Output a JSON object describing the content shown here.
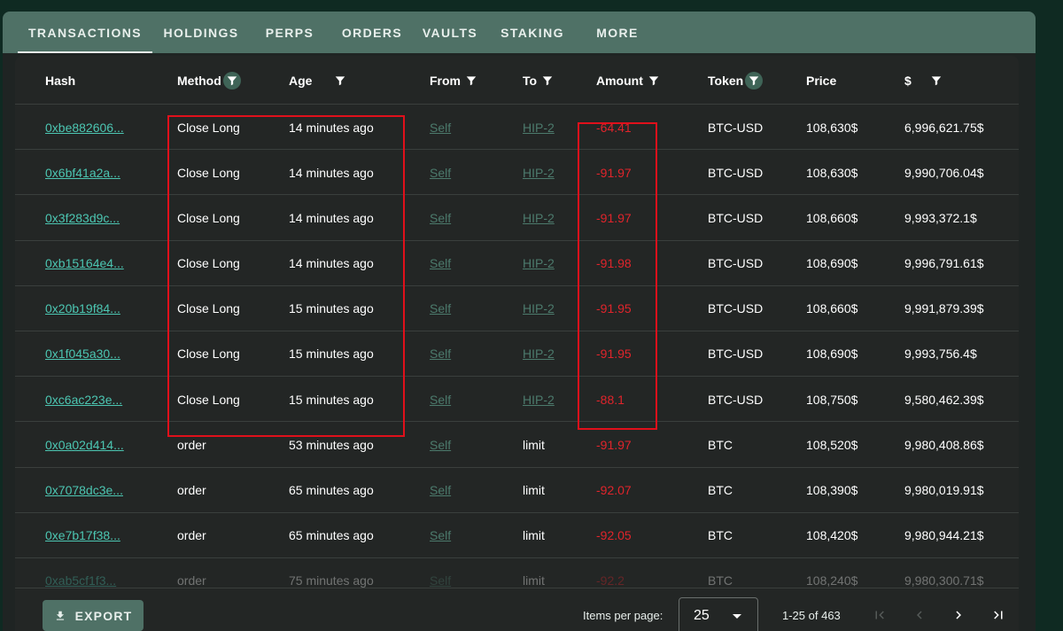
{
  "tabs": [
    {
      "label": "TRANSACTIONS",
      "active": true
    },
    {
      "label": "HOLDINGS"
    },
    {
      "label": "PERPS"
    },
    {
      "label": "ORDERS"
    },
    {
      "label": "VAULTS"
    },
    {
      "label": "STAKING"
    },
    {
      "label": "MORE"
    }
  ],
  "table": {
    "columns": [
      "Hash",
      "Method",
      "Age",
      "From",
      "To",
      "Amount",
      "Token",
      "Price",
      "$"
    ],
    "rows": [
      {
        "hash": "0xbe882606...",
        "method": "Close Long",
        "age": "14 minutes ago",
        "from": "Self",
        "to": "HIP-2",
        "amount": "-64.41",
        "token": "BTC-USD",
        "price": "108,630$",
        "usd": "6,996,621.75$"
      },
      {
        "hash": "0x6bf41a2a...",
        "method": "Close Long",
        "age": "14 minutes ago",
        "from": "Self",
        "to": "HIP-2",
        "amount": "-91.97",
        "token": "BTC-USD",
        "price": "108,630$",
        "usd": "9,990,706.04$"
      },
      {
        "hash": "0x3f283d9c...",
        "method": "Close Long",
        "age": "14 minutes ago",
        "from": "Self",
        "to": "HIP-2",
        "amount": "-91.97",
        "token": "BTC-USD",
        "price": "108,660$",
        "usd": "9,993,372.1$"
      },
      {
        "hash": "0xb15164e4...",
        "method": "Close Long",
        "age": "14 minutes ago",
        "from": "Self",
        "to": "HIP-2",
        "amount": "-91.98",
        "token": "BTC-USD",
        "price": "108,690$",
        "usd": "9,996,791.61$"
      },
      {
        "hash": "0x20b19f84...",
        "method": "Close Long",
        "age": "15 minutes ago",
        "from": "Self",
        "to": "HIP-2",
        "amount": "-91.95",
        "token": "BTC-USD",
        "price": "108,660$",
        "usd": "9,991,879.39$"
      },
      {
        "hash": "0x1f045a30...",
        "method": "Close Long",
        "age": "15 minutes ago",
        "from": "Self",
        "to": "HIP-2",
        "amount": "-91.95",
        "token": "BTC-USD",
        "price": "108,690$",
        "usd": "9,993,756.4$"
      },
      {
        "hash": "0xc6ac223e...",
        "method": "Close Long",
        "age": "15 minutes ago",
        "from": "Self",
        "to": "HIP-2",
        "amount": "-88.1",
        "token": "BTC-USD",
        "price": "108,750$",
        "usd": "9,580,462.39$"
      },
      {
        "hash": "0x0a02d414...",
        "method": "order",
        "age": "53 minutes ago",
        "from": "Self",
        "to": "limit",
        "amount": "-91.97",
        "token": "BTC",
        "price": "108,520$",
        "usd": "9,980,408.86$"
      },
      {
        "hash": "0x7078dc3e...",
        "method": "order",
        "age": "65 minutes ago",
        "from": "Self",
        "to": "limit",
        "amount": "-92.07",
        "token": "BTC",
        "price": "108,390$",
        "usd": "9,980,019.91$"
      },
      {
        "hash": "0xe7b17f38...",
        "method": "order",
        "age": "65 minutes ago",
        "from": "Self",
        "to": "limit",
        "amount": "-92.05",
        "token": "BTC",
        "price": "108,420$",
        "usd": "9,980,944.21$"
      },
      {
        "hash": "0xab5cf1f3...",
        "method": "order",
        "age": "75 minutes ago",
        "from": "Self",
        "to": "limit",
        "amount": "-92.2",
        "token": "BTC",
        "price": "108,240$",
        "usd": "9,980,300.71$"
      }
    ]
  },
  "footer": {
    "export_label": "EXPORT",
    "items_per_page_label": "Items per page:",
    "items_per_page_value": "25",
    "range_label": "1-25 of 463"
  },
  "icons": {
    "filter": "filter-icon",
    "download": "download-icon",
    "first": "first-page-icon",
    "prev": "prev-page-icon",
    "next": "next-page-icon",
    "last": "last-page-icon"
  },
  "colors": {
    "tab_bg": "#4f7166",
    "hash_link": "#4cc6b2",
    "address_link": "#4c7a6c",
    "negative": "#e0242b",
    "highlight_box": "#e0101b"
  }
}
